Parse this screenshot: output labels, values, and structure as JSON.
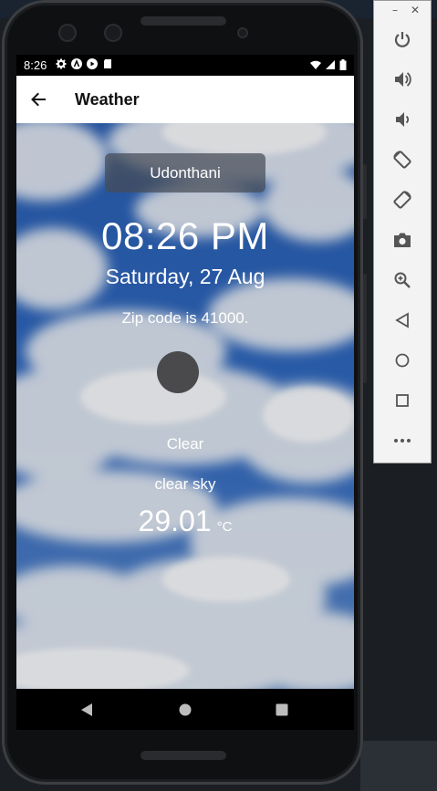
{
  "status_bar": {
    "time": "8:26"
  },
  "app_bar": {
    "title": "Weather"
  },
  "weather": {
    "city": "Udonthani",
    "time": "08:26 PM",
    "date": "Saturday, 27 Aug",
    "zip_text": "Zip code is 41000.",
    "condition": "Clear",
    "description": "clear sky",
    "temperature": "29.01",
    "unit": "°C"
  },
  "emulator": {
    "window_controls": {
      "minimize": "–",
      "close": "✕"
    },
    "buttons": [
      "power-icon",
      "volume-up-icon",
      "volume-down-icon",
      "rotate-left-icon",
      "rotate-right-icon",
      "camera-icon",
      "zoom-icon",
      "back-icon",
      "home-icon",
      "overview-icon",
      "more-icon"
    ]
  },
  "colors": {
    "app_bar": "#ffffff",
    "sky": "#2f63b8",
    "city_box": "#464c56"
  }
}
